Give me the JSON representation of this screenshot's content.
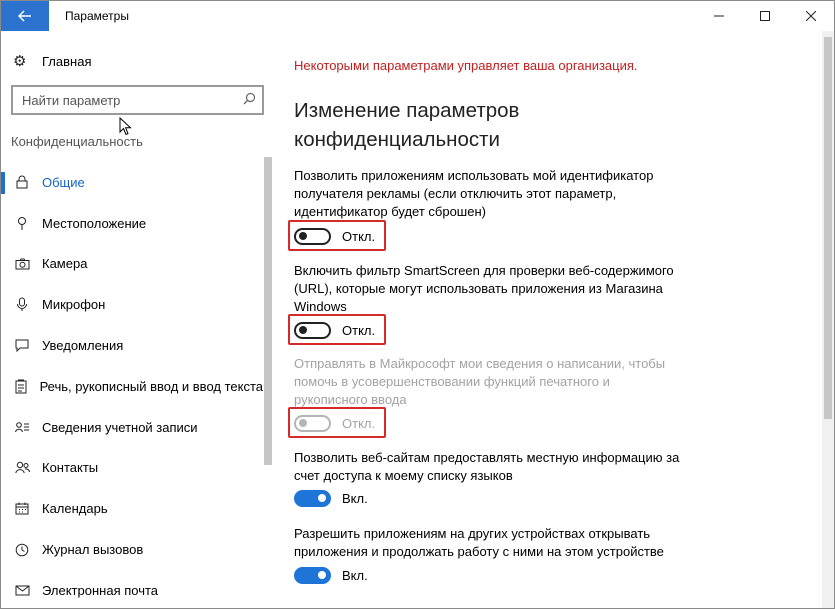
{
  "window": {
    "title": "Параметры",
    "back_icon": "arrow-left-icon",
    "minimize_glyph": "—",
    "maximize_glyph": "☐",
    "close_glyph": "✕"
  },
  "sidebar": {
    "home_label": "Главная",
    "search_placeholder": "Найти параметр",
    "section_label": "Конфиденциальность",
    "items": [
      {
        "label": "Общие",
        "icon": "lock-icon",
        "glyph": "🔒",
        "active": true
      },
      {
        "label": "Местоположение",
        "icon": "location-icon",
        "glyph": "⚲",
        "active": false
      },
      {
        "label": "Камера",
        "icon": "camera-icon",
        "glyph": "◙",
        "active": false
      },
      {
        "label": "Микрофон",
        "icon": "microphone-icon",
        "glyph": "🎙",
        "active": false
      },
      {
        "label": "Уведомления",
        "icon": "notification-icon",
        "glyph": "🗨",
        "active": false
      },
      {
        "label": "Речь, рукописный ввод и ввод текста",
        "icon": "speech-icon",
        "glyph": "📋",
        "active": false
      },
      {
        "label": "Сведения учетной записи",
        "icon": "account-info-icon",
        "glyph": "☰",
        "active": false
      },
      {
        "label": "Контакты",
        "icon": "contacts-icon",
        "glyph": "👥",
        "active": false
      },
      {
        "label": "Календарь",
        "icon": "calendar-icon",
        "glyph": "📅",
        "active": false
      },
      {
        "label": "Журнал вызовов",
        "icon": "call-history-icon",
        "glyph": "◷",
        "active": false
      },
      {
        "label": "Электронная почта",
        "icon": "mail-icon",
        "glyph": "✉",
        "active": false
      }
    ]
  },
  "main": {
    "org_message": "Некоторыми параметрами управляет ваша организация.",
    "title": "Изменение параметров конфиденциальности",
    "settings": [
      {
        "description": "Позволить приложениям использовать мой идентификатор получателя рекламы (если отключить этот параметр, идентификатор будет сброшен)",
        "state": "Откл.",
        "on": false,
        "disabled": false
      },
      {
        "description": "Включить фильтр SmartScreen для проверки веб-содержимого (URL), которые могут использовать приложения из Магазина Windows",
        "state": "Откл.",
        "on": false,
        "disabled": false
      },
      {
        "description": "Отправлять в Майкрософт мои сведения о написании, чтобы помочь в усовершенствовании функций печатного и рукописного ввода",
        "state": "Откл.",
        "on": false,
        "disabled": true
      },
      {
        "description": "Позволить веб-сайтам предоставлять местную информацию за счет доступа к моему списку языков",
        "state": "Вкл.",
        "on": true,
        "disabled": false
      },
      {
        "description": "Разрешить приложениям на других устройствах открывать приложения и продолжать работу с ними на этом устройстве",
        "state": "Вкл.",
        "on": true,
        "disabled": false
      }
    ]
  }
}
